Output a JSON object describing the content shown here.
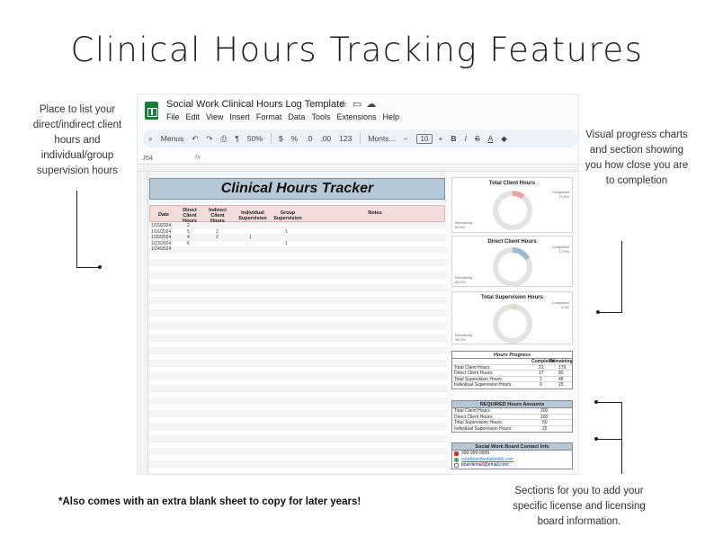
{
  "page": {
    "title": "Clinical Hours Tracking Features",
    "note_left": "Place to list your direct/indirect client hours and individual/group supervision hours",
    "note_right_top": "Visual progress charts and section showing you how close you are to completion",
    "note_right_bottom": "Sections for you to add your specific license and licensing board information.",
    "footer": "*Also comes with an extra blank sheet to copy for later years!"
  },
  "sheet": {
    "doc_title": "Social Work Clinical Hours Log Template",
    "title_icons": [
      "star-icon",
      "folder-icon",
      "cloud-icon"
    ],
    "menu": [
      "File",
      "Edit",
      "View",
      "Insert",
      "Format",
      "Data",
      "Tools",
      "Extensions",
      "Help"
    ],
    "toolbar": {
      "search": "Menus",
      "zoom": "50%",
      "currency": "$",
      "percent": "%",
      "dec_decrease": ".0",
      "dec_increase": ".00",
      "number_format": "123",
      "font": "Monts...",
      "minus": "−",
      "font_size": "10",
      "plus": "+",
      "bold": "B",
      "italic": "I",
      "strike": "S",
      "text_color": "A"
    },
    "name_box": "J54",
    "fx": "fx",
    "tracker": {
      "title": "Clinical Hours Tracker",
      "headers": [
        "Date",
        "Direct Client Hours",
        "Indirect Client Hours",
        "Individual Supervision",
        "Group Supervision",
        "Notes"
      ],
      "rows": [
        [
          "1/15/2024",
          "2",
          "",
          "",
          "",
          ""
        ],
        [
          "1/16/2024",
          "5",
          "2",
          "",
          "1",
          ""
        ],
        [
          "1/20/2024",
          "4",
          "2",
          "1",
          "",
          ""
        ],
        [
          "1/23/2024",
          "6",
          "",
          "",
          "1",
          ""
        ],
        [
          "1/24/2024",
          "",
          "",
          "",
          "",
          ""
        ]
      ]
    },
    "charts": [
      {
        "title": "Total Client Hours",
        "completed_label": "Completed",
        "completed_pct": "10.5%",
        "remaining_label": "Remaining",
        "remaining_pct": "89.5%",
        "fraction": 0.105,
        "color": "#e8a7a7"
      },
      {
        "title": "Direct Client Hours",
        "completed_label": "Completed",
        "completed_pct": "17.0%",
        "remaining_label": "Remaining",
        "remaining_pct": "83.0%",
        "fraction": 0.17,
        "color": "#9fb9d1"
      },
      {
        "title": "Total Supervision Hours",
        "completed_label": "Completed",
        "completed_pct": "4.0%",
        "remaining_label": "Remaining",
        "remaining_pct": "96.0%",
        "fraction": 0.04,
        "color": "#cfe3a8"
      }
    ],
    "progress": {
      "title": "Hours Progress",
      "col_completed": "Completed",
      "col_remaining": "Remaining",
      "rows": [
        {
          "label": "Total Client Hours:",
          "completed": "21",
          "remaining": "179"
        },
        {
          "label": "Direct Client Hours:",
          "completed": "17",
          "remaining": "83"
        },
        {
          "label": "Total Supervision Hours:",
          "completed": "2",
          "remaining": "48"
        },
        {
          "label": "Individual Supervision Hours:",
          "completed": "0",
          "remaining": "25"
        }
      ]
    },
    "required": {
      "title": "REQUIRED Hours Amounts",
      "rows": [
        {
          "label": "Total Client Hours:",
          "value": "200"
        },
        {
          "label": "Direct Client Hours:",
          "value": "100"
        },
        {
          "label": "Total Supervision Hours:",
          "value": "50"
        },
        {
          "label": "Individual Supervision Hours:",
          "value": "25"
        }
      ]
    },
    "contact": {
      "title": "Social Work Board Contact Info",
      "phone": "999-999-9999",
      "website": "yourboardwebsitelink.com",
      "email": "boardemail@email.com"
    }
  }
}
